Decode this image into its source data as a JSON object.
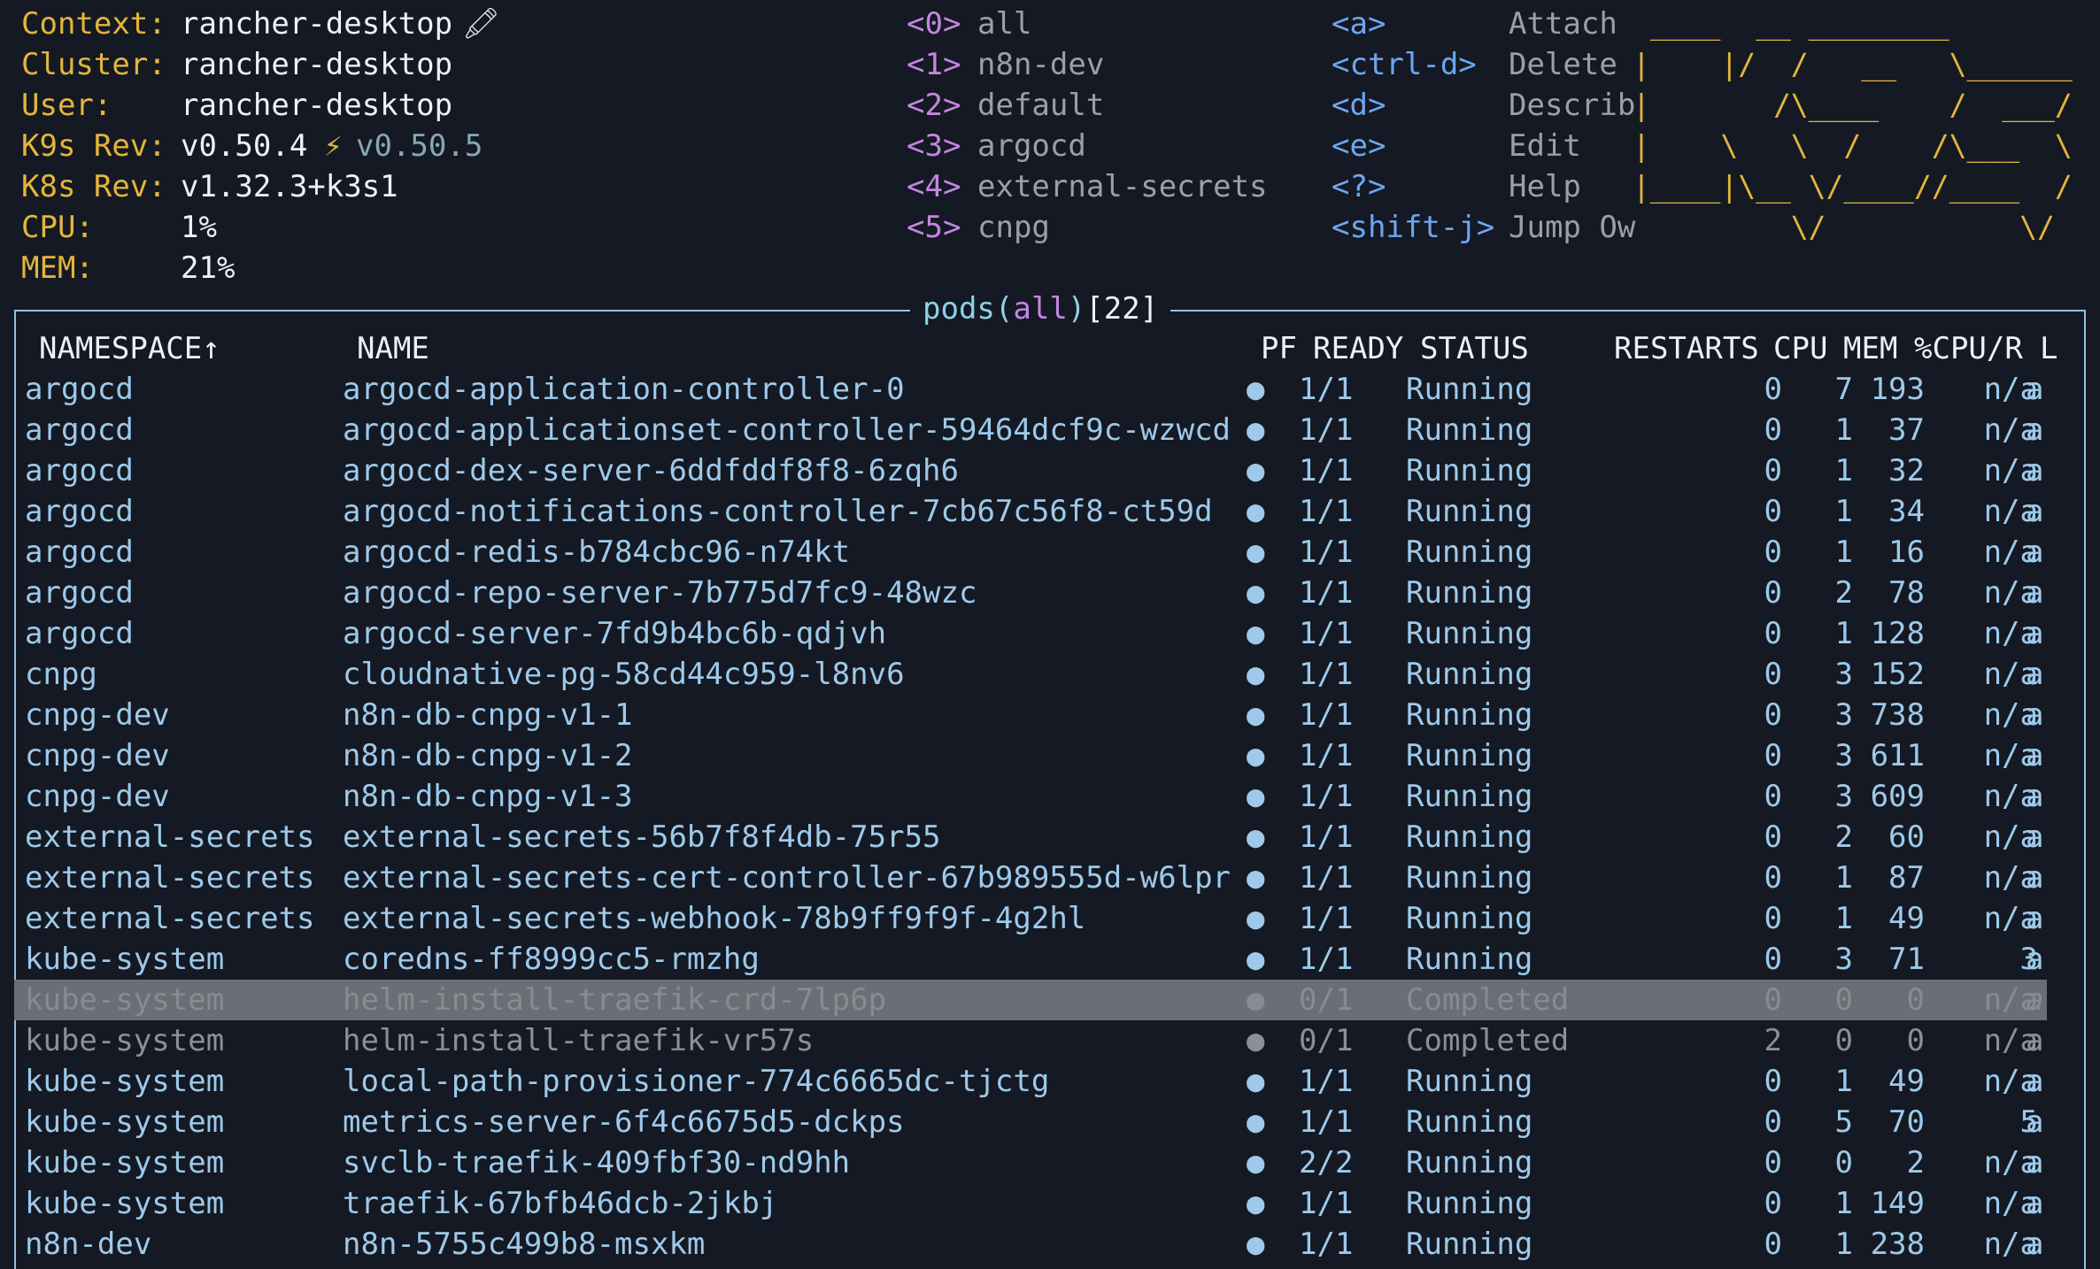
{
  "info": [
    {
      "label": "Context:",
      "value": "rancher-desktop",
      "extra": "🖍"
    },
    {
      "label": "Cluster:",
      "value": "rancher-desktop"
    },
    {
      "label": "User:",
      "value": "rancher-desktop"
    },
    {
      "label": "K9s Rev:",
      "value": "v0.50.4",
      "bolt": "⚡",
      "update": "v0.50.5"
    },
    {
      "label": "K8s Rev:",
      "value": "v1.32.3+k3s1"
    },
    {
      "label": "CPU:",
      "value": "1%"
    },
    {
      "label": "MEM:",
      "value": "21%"
    }
  ],
  "namespaces": [
    {
      "key": "<0>",
      "name": "all"
    },
    {
      "key": "<1>",
      "name": "n8n-dev"
    },
    {
      "key": "<2>",
      "name": "default"
    },
    {
      "key": "<3>",
      "name": "argocd"
    },
    {
      "key": "<4>",
      "name": "external-secrets"
    },
    {
      "key": "<5>",
      "name": "cnpg"
    }
  ],
  "shortcuts": [
    {
      "key": "<a>",
      "action": "Attach"
    },
    {
      "key": "<ctrl-d>",
      "action": "Delete"
    },
    {
      "key": "<d>",
      "action": "Describ"
    },
    {
      "key": "<e>",
      "action": "Edit"
    },
    {
      "key": "<?>",
      "action": "Help"
    },
    {
      "key": "<shift-j>",
      "action": "Jump Ow"
    }
  ],
  "logo_lines": [
    " ____  __ ________",
    "|    |/  /   __   \\______",
    "|       /\\____    /  ___/",
    "|    \\   \\  /    /\\___  \\",
    "|____|\\__ \\/____//____  /",
    "         \\/           \\/"
  ],
  "title": {
    "resource": "pods",
    "open": "(",
    "scope": "all",
    "close": ")",
    "count": "[22]"
  },
  "columns": {
    "namespace": "NAMESPACE↑",
    "name": "NAME",
    "pf": "PF",
    "ready": "READY",
    "status": "STATUS",
    "restarts": "RESTARTS",
    "cpu": "CPU",
    "mem": "MEM",
    "cpu_r": "%CPU/R",
    "l": "L"
  },
  "rows": [
    {
      "ns": "argocd",
      "name": "argocd-application-controller-0",
      "pf": "●",
      "ready": "1/1",
      "status": "Running",
      "restarts": "0",
      "cpu": "7",
      "mem": "193",
      "cpur": "n/a",
      "l": "a"
    },
    {
      "ns": "argocd",
      "name": "argocd-applicationset-controller-59464dcf9c-wzwcd",
      "pf": "●",
      "ready": "1/1",
      "status": "Running",
      "restarts": "0",
      "cpu": "1",
      "mem": "37",
      "cpur": "n/a",
      "l": "a"
    },
    {
      "ns": "argocd",
      "name": "argocd-dex-server-6ddfddf8f8-6zqh6",
      "pf": "●",
      "ready": "1/1",
      "status": "Running",
      "restarts": "0",
      "cpu": "1",
      "mem": "32",
      "cpur": "n/a",
      "l": "a"
    },
    {
      "ns": "argocd",
      "name": "argocd-notifications-controller-7cb67c56f8-ct59d",
      "pf": "●",
      "ready": "1/1",
      "status": "Running",
      "restarts": "0",
      "cpu": "1",
      "mem": "34",
      "cpur": "n/a",
      "l": "a"
    },
    {
      "ns": "argocd",
      "name": "argocd-redis-b784cbc96-n74kt",
      "pf": "●",
      "ready": "1/1",
      "status": "Running",
      "restarts": "0",
      "cpu": "1",
      "mem": "16",
      "cpur": "n/a",
      "l": "a"
    },
    {
      "ns": "argocd",
      "name": "argocd-repo-server-7b775d7fc9-48wzc",
      "pf": "●",
      "ready": "1/1",
      "status": "Running",
      "restarts": "0",
      "cpu": "2",
      "mem": "78",
      "cpur": "n/a",
      "l": "a"
    },
    {
      "ns": "argocd",
      "name": "argocd-server-7fd9b4bc6b-qdjvh",
      "pf": "●",
      "ready": "1/1",
      "status": "Running",
      "restarts": "0",
      "cpu": "1",
      "mem": "128",
      "cpur": "n/a",
      "l": "a"
    },
    {
      "ns": "cnpg",
      "name": "cloudnative-pg-58cd44c959-l8nv6",
      "pf": "●",
      "ready": "1/1",
      "status": "Running",
      "restarts": "0",
      "cpu": "3",
      "mem": "152",
      "cpur": "n/a",
      "l": "a"
    },
    {
      "ns": "cnpg-dev",
      "name": "n8n-db-cnpg-v1-1",
      "pf": "●",
      "ready": "1/1",
      "status": "Running",
      "restarts": "0",
      "cpu": "3",
      "mem": "738",
      "cpur": "n/a",
      "l": "a"
    },
    {
      "ns": "cnpg-dev",
      "name": "n8n-db-cnpg-v1-2",
      "pf": "●",
      "ready": "1/1",
      "status": "Running",
      "restarts": "0",
      "cpu": "3",
      "mem": "611",
      "cpur": "n/a",
      "l": "a"
    },
    {
      "ns": "cnpg-dev",
      "name": "n8n-db-cnpg-v1-3",
      "pf": "●",
      "ready": "1/1",
      "status": "Running",
      "restarts": "0",
      "cpu": "3",
      "mem": "609",
      "cpur": "n/a",
      "l": "a"
    },
    {
      "ns": "external-secrets",
      "name": "external-secrets-56b7f8f4db-75r55",
      "pf": "●",
      "ready": "1/1",
      "status": "Running",
      "restarts": "0",
      "cpu": "2",
      "mem": "60",
      "cpur": "n/a",
      "l": "a"
    },
    {
      "ns": "external-secrets",
      "name": "external-secrets-cert-controller-67b989555d-w6lpr",
      "pf": "●",
      "ready": "1/1",
      "status": "Running",
      "restarts": "0",
      "cpu": "1",
      "mem": "87",
      "cpur": "n/a",
      "l": "a"
    },
    {
      "ns": "external-secrets",
      "name": "external-secrets-webhook-78b9ff9f9f-4g2hl",
      "pf": "●",
      "ready": "1/1",
      "status": "Running",
      "restarts": "0",
      "cpu": "1",
      "mem": "49",
      "cpur": "n/a",
      "l": "a"
    },
    {
      "ns": "kube-system",
      "name": "coredns-ff8999cc5-rmzhg",
      "pf": "●",
      "ready": "1/1",
      "status": "Running",
      "restarts": "0",
      "cpu": "3",
      "mem": "71",
      "cpur": "3",
      "l": "a"
    },
    {
      "ns": "kube-system",
      "name": "helm-install-traefik-crd-7lp6p",
      "pf": "●",
      "ready": "0/1",
      "status": "Completed",
      "restarts": "0",
      "cpu": "0",
      "mem": "0",
      "cpur": "n/a",
      "l": "a",
      "selected": true
    },
    {
      "ns": "kube-system",
      "name": "helm-install-traefik-vr57s",
      "pf": "●",
      "ready": "0/1",
      "status": "Completed",
      "restarts": "2",
      "cpu": "0",
      "mem": "0",
      "cpur": "n/a",
      "l": "a",
      "completed": true
    },
    {
      "ns": "kube-system",
      "name": "local-path-provisioner-774c6665dc-tjctg",
      "pf": "●",
      "ready": "1/1",
      "status": "Running",
      "restarts": "0",
      "cpu": "1",
      "mem": "49",
      "cpur": "n/a",
      "l": "a"
    },
    {
      "ns": "kube-system",
      "name": "metrics-server-6f4c6675d5-dckps",
      "pf": "●",
      "ready": "1/1",
      "status": "Running",
      "restarts": "0",
      "cpu": "5",
      "mem": "70",
      "cpur": "5",
      "l": "a"
    },
    {
      "ns": "kube-system",
      "name": "svclb-traefik-409fbf30-nd9hh",
      "pf": "●",
      "ready": "2/2",
      "status": "Running",
      "restarts": "0",
      "cpu": "0",
      "mem": "2",
      "cpur": "n/a",
      "l": "a"
    },
    {
      "ns": "kube-system",
      "name": "traefik-67bfb46dcb-2jkbj",
      "pf": "●",
      "ready": "1/1",
      "status": "Running",
      "restarts": "0",
      "cpu": "1",
      "mem": "149",
      "cpur": "n/a",
      "l": "a"
    },
    {
      "ns": "n8n-dev",
      "name": "n8n-5755c499b8-msxkm",
      "pf": "●",
      "ready": "1/1",
      "status": "Running",
      "restarts": "0",
      "cpu": "1",
      "mem": "238",
      "cpur": "n/a",
      "l": "a"
    }
  ]
}
